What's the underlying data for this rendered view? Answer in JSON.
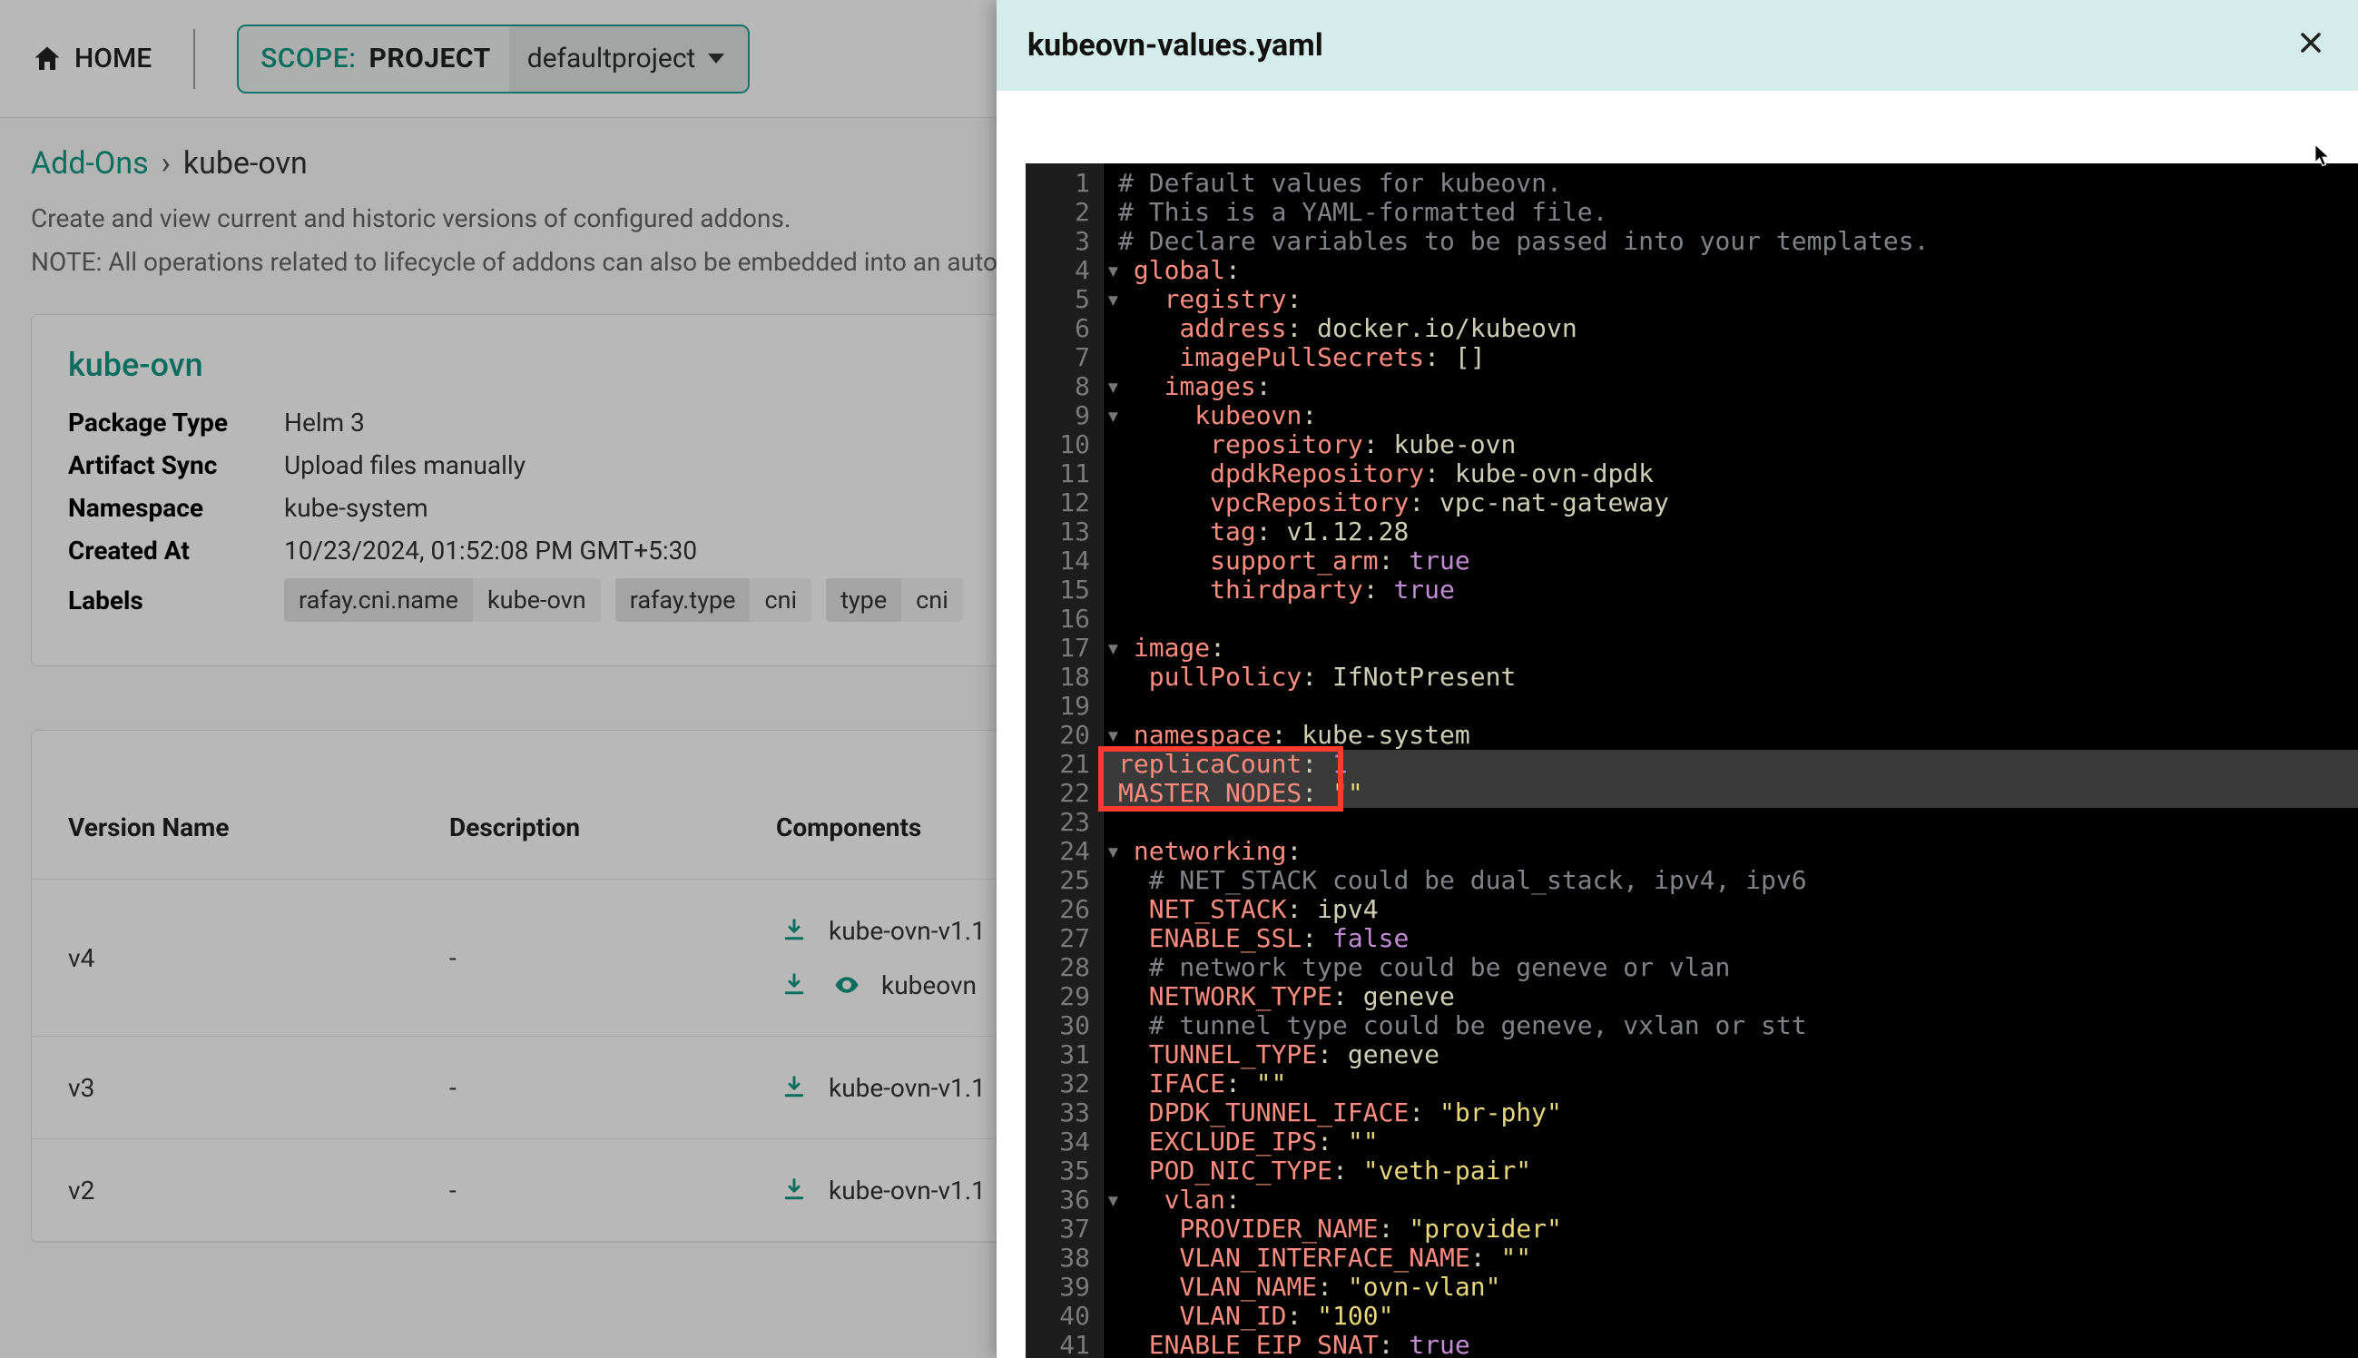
{
  "topbar": {
    "home_label": "HOME",
    "scope_prefix": "SCOPE:",
    "scope_kind": "PROJECT",
    "scope_value": "defaultproject"
  },
  "breadcrumb": {
    "root": "Add-Ons",
    "sep": "›",
    "current": "kube-ovn"
  },
  "page_desc_1": "Create and view current and historic versions of configured addons.",
  "page_desc_2": "NOTE: All operations related to lifecycle of addons can also be embedded into an auto",
  "card": {
    "title": "kube-ovn",
    "meta": {
      "package_type_k": "Package Type",
      "package_type_v": "Helm 3",
      "artifact_sync_k": "Artifact Sync",
      "artifact_sync_v": "Upload files manually",
      "namespace_k": "Namespace",
      "namespace_v": "kube-system",
      "created_at_k": "Created At",
      "created_at_v": "10/23/2024, 01:52:08 PM GMT+5:30",
      "labels_k": "Labels"
    },
    "labels": [
      {
        "key": "rafay.cni.name",
        "val": "kube-ovn"
      },
      {
        "key": "rafay.type",
        "val": "cni"
      },
      {
        "key": "type",
        "val": "cni"
      }
    ]
  },
  "table": {
    "headers": {
      "version": "Version Name",
      "description": "Description",
      "components": "Components"
    },
    "rows": [
      {
        "version": "v4",
        "description": "-",
        "components": [
          {
            "name": "kube-ovn-v1.1",
            "download": true,
            "view": false
          },
          {
            "name": "kubeovn",
            "download": true,
            "view": true
          }
        ]
      },
      {
        "version": "v3",
        "description": "-",
        "components": [
          {
            "name": "kube-ovn-v1.1",
            "download": true,
            "view": false
          }
        ]
      },
      {
        "version": "v2",
        "description": "-",
        "components": [
          {
            "name": "kube-ovn-v1.1",
            "download": true,
            "view": false
          }
        ]
      }
    ]
  },
  "panel": {
    "title": "kubeovn-values.yaml"
  },
  "yaml_lines": [
    {
      "n": 1,
      "t": [
        [
          "com",
          "# Default values for kubeovn."
        ]
      ]
    },
    {
      "n": 2,
      "t": [
        [
          "com",
          "# This is a YAML-formatted file."
        ]
      ]
    },
    {
      "n": 3,
      "t": [
        [
          "com",
          "# Declare variables to be passed into your templates."
        ]
      ]
    },
    {
      "n": 4,
      "fold": true,
      "t": [
        [
          "key",
          "global"
        ],
        [
          "punct",
          ":"
        ]
      ]
    },
    {
      "n": 5,
      "fold": true,
      "t": [
        [
          "pad",
          "  "
        ],
        [
          "key",
          "registry"
        ],
        [
          "punct",
          ":"
        ]
      ]
    },
    {
      "n": 6,
      "t": [
        [
          "pad",
          "    "
        ],
        [
          "key",
          "address"
        ],
        [
          "punct",
          ": "
        ],
        [
          "val",
          "docker.io/kubeovn"
        ]
      ]
    },
    {
      "n": 7,
      "t": [
        [
          "pad",
          "    "
        ],
        [
          "key",
          "imagePullSecrets"
        ],
        [
          "punct",
          ": "
        ],
        [
          "brack",
          "[]"
        ]
      ]
    },
    {
      "n": 8,
      "fold": true,
      "t": [
        [
          "pad",
          "  "
        ],
        [
          "key",
          "images"
        ],
        [
          "punct",
          ":"
        ]
      ]
    },
    {
      "n": 9,
      "fold": true,
      "t": [
        [
          "pad",
          "    "
        ],
        [
          "key",
          "kubeovn"
        ],
        [
          "punct",
          ":"
        ]
      ]
    },
    {
      "n": 10,
      "t": [
        [
          "pad",
          "      "
        ],
        [
          "key",
          "repository"
        ],
        [
          "punct",
          ": "
        ],
        [
          "val",
          "kube-ovn"
        ]
      ]
    },
    {
      "n": 11,
      "t": [
        [
          "pad",
          "      "
        ],
        [
          "key",
          "dpdkRepository"
        ],
        [
          "punct",
          ": "
        ],
        [
          "val",
          "kube-ovn-dpdk"
        ]
      ]
    },
    {
      "n": 12,
      "t": [
        [
          "pad",
          "      "
        ],
        [
          "key",
          "vpcRepository"
        ],
        [
          "punct",
          ": "
        ],
        [
          "val",
          "vpc-nat-gateway"
        ]
      ]
    },
    {
      "n": 13,
      "t": [
        [
          "pad",
          "      "
        ],
        [
          "key",
          "tag"
        ],
        [
          "punct",
          ": "
        ],
        [
          "val",
          "v1.12.28"
        ]
      ]
    },
    {
      "n": 14,
      "t": [
        [
          "pad",
          "      "
        ],
        [
          "key",
          "support_arm"
        ],
        [
          "punct",
          ": "
        ],
        [
          "bool",
          "true"
        ]
      ]
    },
    {
      "n": 15,
      "t": [
        [
          "pad",
          "      "
        ],
        [
          "key",
          "thirdparty"
        ],
        [
          "punct",
          ": "
        ],
        [
          "bool",
          "true"
        ]
      ]
    },
    {
      "n": 16,
      "t": []
    },
    {
      "n": 17,
      "fold": true,
      "t": [
        [
          "key",
          "image"
        ],
        [
          "punct",
          ":"
        ]
      ]
    },
    {
      "n": 18,
      "t": [
        [
          "pad",
          "  "
        ],
        [
          "key",
          "pullPolicy"
        ],
        [
          "punct",
          ": "
        ],
        [
          "val",
          "IfNotPresent"
        ]
      ]
    },
    {
      "n": 19,
      "t": []
    },
    {
      "n": 20,
      "fold": true,
      "t": [
        [
          "key",
          "namespace"
        ],
        [
          "punct",
          ": "
        ],
        [
          "val",
          "kube-system"
        ]
      ]
    },
    {
      "n": 21,
      "hl": true,
      "t": [
        [
          "key",
          "replicaCount"
        ],
        [
          "punct",
          ": "
        ],
        [
          "num",
          "1"
        ]
      ]
    },
    {
      "n": 22,
      "hl": true,
      "t": [
        [
          "key",
          "MASTER_NODES"
        ],
        [
          "punct",
          ": "
        ],
        [
          "str",
          "\"\""
        ]
      ]
    },
    {
      "n": 23,
      "t": []
    },
    {
      "n": 24,
      "fold": true,
      "t": [
        [
          "key",
          "networking"
        ],
        [
          "punct",
          ":"
        ]
      ]
    },
    {
      "n": 25,
      "t": [
        [
          "pad",
          "  "
        ],
        [
          "com",
          "# NET_STACK could be dual_stack, ipv4, ipv6"
        ]
      ]
    },
    {
      "n": 26,
      "t": [
        [
          "pad",
          "  "
        ],
        [
          "key",
          "NET_STACK"
        ],
        [
          "punct",
          ": "
        ],
        [
          "val",
          "ipv4"
        ]
      ]
    },
    {
      "n": 27,
      "t": [
        [
          "pad",
          "  "
        ],
        [
          "key",
          "ENABLE_SSL"
        ],
        [
          "punct",
          ": "
        ],
        [
          "bool",
          "false"
        ]
      ]
    },
    {
      "n": 28,
      "t": [
        [
          "pad",
          "  "
        ],
        [
          "com",
          "# network type could be geneve or vlan"
        ]
      ]
    },
    {
      "n": 29,
      "t": [
        [
          "pad",
          "  "
        ],
        [
          "key",
          "NETWORK_TYPE"
        ],
        [
          "punct",
          ": "
        ],
        [
          "val",
          "geneve"
        ]
      ]
    },
    {
      "n": 30,
      "t": [
        [
          "pad",
          "  "
        ],
        [
          "com",
          "# tunnel type could be geneve, vxlan or stt"
        ]
      ]
    },
    {
      "n": 31,
      "t": [
        [
          "pad",
          "  "
        ],
        [
          "key",
          "TUNNEL_TYPE"
        ],
        [
          "punct",
          ": "
        ],
        [
          "val",
          "geneve"
        ]
      ]
    },
    {
      "n": 32,
      "t": [
        [
          "pad",
          "  "
        ],
        [
          "key",
          "IFACE"
        ],
        [
          "punct",
          ": "
        ],
        [
          "str",
          "\"\""
        ]
      ]
    },
    {
      "n": 33,
      "t": [
        [
          "pad",
          "  "
        ],
        [
          "key",
          "DPDK_TUNNEL_IFACE"
        ],
        [
          "punct",
          ": "
        ],
        [
          "str",
          "\"br-phy\""
        ]
      ]
    },
    {
      "n": 34,
      "t": [
        [
          "pad",
          "  "
        ],
        [
          "key",
          "EXCLUDE_IPS"
        ],
        [
          "punct",
          ": "
        ],
        [
          "str",
          "\"\""
        ]
      ]
    },
    {
      "n": 35,
      "t": [
        [
          "pad",
          "  "
        ],
        [
          "key",
          "POD_NIC_TYPE"
        ],
        [
          "punct",
          ": "
        ],
        [
          "str",
          "\"veth-pair\""
        ]
      ]
    },
    {
      "n": 36,
      "fold": true,
      "t": [
        [
          "pad",
          "  "
        ],
        [
          "key",
          "vlan"
        ],
        [
          "punct",
          ":"
        ]
      ]
    },
    {
      "n": 37,
      "t": [
        [
          "pad",
          "    "
        ],
        [
          "key",
          "PROVIDER_NAME"
        ],
        [
          "punct",
          ": "
        ],
        [
          "str",
          "\"provider\""
        ]
      ]
    },
    {
      "n": 38,
      "t": [
        [
          "pad",
          "    "
        ],
        [
          "key",
          "VLAN_INTERFACE_NAME"
        ],
        [
          "punct",
          ": "
        ],
        [
          "str",
          "\"\""
        ]
      ]
    },
    {
      "n": 39,
      "t": [
        [
          "pad",
          "    "
        ],
        [
          "key",
          "VLAN_NAME"
        ],
        [
          "punct",
          ": "
        ],
        [
          "str",
          "\"ovn-vlan\""
        ]
      ]
    },
    {
      "n": 40,
      "t": [
        [
          "pad",
          "    "
        ],
        [
          "key",
          "VLAN_ID"
        ],
        [
          "punct",
          ": "
        ],
        [
          "str",
          "\"100\""
        ]
      ]
    },
    {
      "n": 41,
      "t": [
        [
          "pad",
          "  "
        ],
        [
          "key",
          "ENABLE_EIP_SNAT"
        ],
        [
          "punct",
          ": "
        ],
        [
          "bool",
          "true"
        ]
      ]
    }
  ],
  "highlight_box": {
    "from_line": 21,
    "to_line": 22
  }
}
